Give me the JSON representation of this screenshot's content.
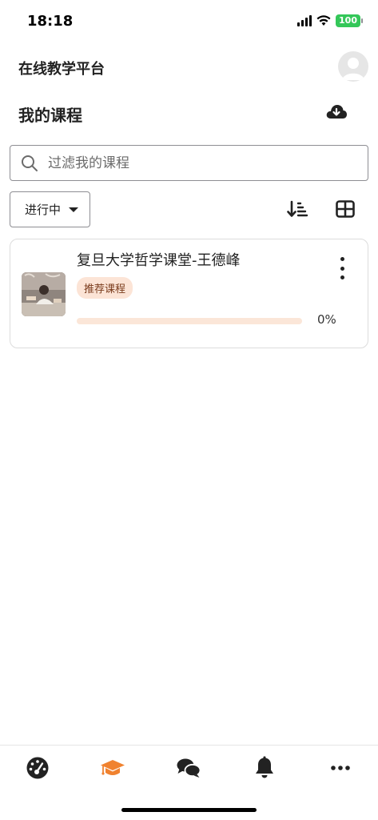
{
  "status_bar": {
    "time": "18:18",
    "battery": "100"
  },
  "header": {
    "app_title": "在线教学平台"
  },
  "section": {
    "title": "我的课程"
  },
  "search": {
    "placeholder": "过滤我的课程",
    "value": ""
  },
  "filter": {
    "selected": "进行中"
  },
  "courses": [
    {
      "name": "复旦大学哲学课堂-王德峰",
      "badge": "推荐课程",
      "progress_percent": 0,
      "progress_text": "0%"
    }
  ],
  "colors": {
    "accent": "#f0822f",
    "badge_bg": "#fce4d6",
    "battery": "#34c759"
  },
  "icons": {
    "download": "cloud-download-icon",
    "search": "search-icon",
    "sort": "sort-descending-icon",
    "grid": "grid-view-icon",
    "nav": [
      "dashboard-icon",
      "graduation-cap-icon",
      "chat-icon",
      "bell-icon",
      "more-icon"
    ]
  }
}
